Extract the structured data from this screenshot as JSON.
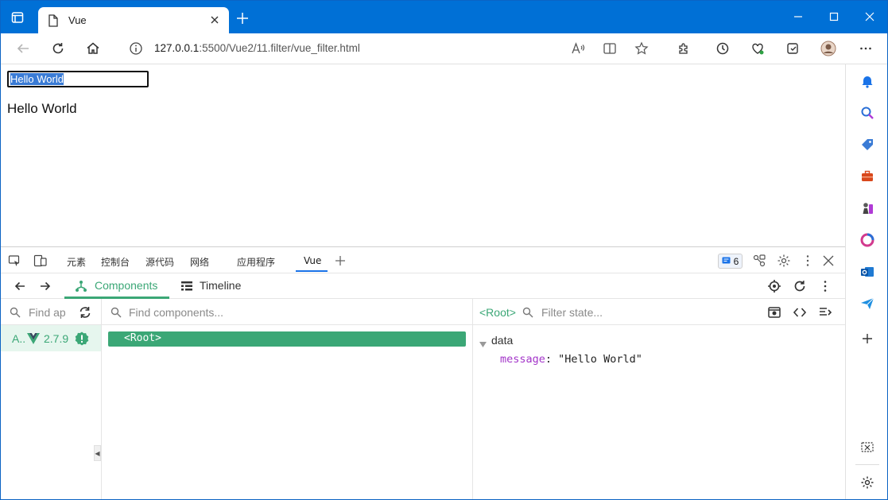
{
  "browser": {
    "tab_title": "Vue",
    "url_host": "127.0.0.1",
    "url_path": ":5500/Vue2/11.filter/vue_filter.html"
  },
  "page": {
    "input_value": "Hello World",
    "display_text": "Hello World"
  },
  "devtools": {
    "tabs": [
      "元素",
      "控制台",
      "源代码",
      "网络",
      "应用程序",
      "Vue"
    ],
    "issues_count": "6",
    "vue": {
      "components_label": "Components",
      "timeline_label": "Timeline",
      "find_apps_placeholder": "Find ap",
      "find_components_placeholder": "Find components...",
      "filter_state_placeholder": "Filter state...",
      "app_name": "A..",
      "vue_version": "2.7.9",
      "root_component": "<Root>",
      "state_header": "<Root>",
      "data_section": "data",
      "data_key": "message",
      "data_value": "\"Hello World\""
    }
  },
  "colors": {
    "titlebar": "#0070d6",
    "vue_green": "#3ba776",
    "active_tab": "#1a73e8"
  }
}
